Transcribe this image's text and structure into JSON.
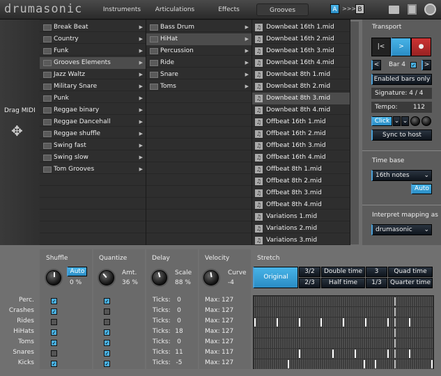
{
  "header": {
    "logo": "drumasonic",
    "tabs": [
      "Instruments",
      "Articulations",
      "Effects",
      "Grooves"
    ],
    "selected_tab": "Grooves",
    "a": "A",
    "arrows": ">>>",
    "b": "B"
  },
  "left": {
    "drag_label": "Drag MIDI"
  },
  "browser": {
    "styles": [
      "Break Beat",
      "Country",
      "Funk",
      "Grooves Elements",
      "Jazz Waltz",
      "Military Snare",
      "Punk",
      "Reggae binary",
      "Reggae Dancehall",
      "Reggae shuffle",
      "Swing fast",
      "Swing slow",
      "Tom Grooves"
    ],
    "styles_selected": 3,
    "instruments": [
      "Bass Drum",
      "HiHat",
      "Percussion",
      "Ride",
      "Snare",
      "Toms"
    ],
    "instruments_selected": 1,
    "files": [
      "Downbeat 16th 1.mid",
      "Downbeat 16th 2.mid",
      "Downbeat 16th 3.mid",
      "Downbeat 16th 4.mid",
      "Downbeat 8th 1.mid",
      "Downbeat 8th 2.mid",
      "Downbeat 8th 3.mid",
      "Downbeat 8th 4.mid",
      "Offbeat 16th 1.mid",
      "Offbeat 16th 2.mid",
      "Offbeat 16th 3.mid",
      "Offbeat 16th 4.mid",
      "Offbeat 8th 1.mid",
      "Offbeat 8th 2.mid",
      "Offbeat 8th 3.mid",
      "Offbeat 8th 4.mid",
      "Variations 1.mid",
      "Variations 2.mid",
      "Variations 3.mid"
    ],
    "files_selected": 6
  },
  "transport": {
    "title": "Transport",
    "rewind": "|<",
    "play": ">",
    "record": "●",
    "prev": "<",
    "bar": "Bar 4",
    "next": ">",
    "enabled_bars": "Enabled bars only",
    "signature": "Signature: 4 / 4",
    "tempo_label": "Tempo:",
    "tempo": "112",
    "click": "Click",
    "sync": "Sync to host"
  },
  "timebase": {
    "title": "Time base",
    "value": "16th notes",
    "auto": "Auto"
  },
  "mapping": {
    "title": "Interpret mapping as",
    "value": "drumasonic"
  },
  "controls": {
    "shuffle": {
      "title": "Shuffle",
      "auto": "Auto",
      "value": "0 %"
    },
    "quantize": {
      "title": "Quantize",
      "label": "Amt.",
      "value": "36 %"
    },
    "delay": {
      "title": "Delay",
      "label": "Scale",
      "value": "88 %"
    },
    "velocity": {
      "title": "Velocity",
      "label": "Curve",
      "value": "-4"
    },
    "stretch": {
      "title": "Stretch",
      "original": "Original",
      "options": [
        "3/2",
        "Double time",
        "3",
        "Quad time",
        "2/3",
        "Half time",
        "1/3",
        "Quarter time"
      ]
    }
  },
  "tracks": [
    {
      "name": "Perc.",
      "shuffle": true,
      "quantize": true,
      "ticks_label": "Ticks:",
      "ticks": "0",
      "max_label": "Max:",
      "max": "127",
      "hits": []
    },
    {
      "name": "Crashes",
      "shuffle": true,
      "quantize": false,
      "ticks_label": "Ticks:",
      "ticks": "0",
      "max_label": "Max:",
      "max": "127",
      "hits": []
    },
    {
      "name": "Rides",
      "shuffle": false,
      "quantize": false,
      "ticks_label": "Ticks:",
      "ticks": "0",
      "max_label": "Max:",
      "max": "127",
      "hits": [
        0,
        0.125,
        0.25,
        0.375,
        0.5,
        0.625,
        0.75,
        0.875
      ]
    },
    {
      "name": "HiHats",
      "shuffle": true,
      "quantize": true,
      "ticks_label": "Ticks:",
      "ticks": "18",
      "max_label": "Max:",
      "max": "127",
      "hits": []
    },
    {
      "name": "Toms",
      "shuffle": true,
      "quantize": true,
      "ticks_label": "Ticks:",
      "ticks": "0",
      "max_label": "Max:",
      "max": "127",
      "hits": []
    },
    {
      "name": "Snares",
      "shuffle": false,
      "quantize": true,
      "ticks_label": "Ticks:",
      "ticks": "11",
      "max_label": "Max:",
      "max": "117",
      "hits": [
        0.25,
        0.44,
        0.565,
        0.75,
        0.875
      ]
    },
    {
      "name": "Kicks",
      "shuffle": true,
      "quantize": true,
      "ticks_label": "Ticks:",
      "ticks": "-5",
      "max_label": "Max:",
      "max": "127",
      "hits": [
        0.19,
        0.62,
        0.68,
        1.0
      ]
    }
  ],
  "playhead": 0.79
}
